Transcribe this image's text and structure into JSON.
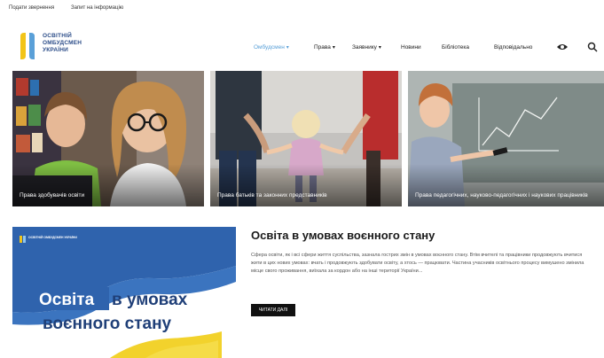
{
  "topbar": {
    "links": [
      "Подати звернення",
      "Запит на інформацію"
    ]
  },
  "logo": {
    "line1": "ОСВІТНІЙ",
    "line2": "ОМБУДСМЕН",
    "line3": "УКРАЇНИ"
  },
  "nav": {
    "items": [
      {
        "label": "Омбудсмен",
        "has_dropdown": true,
        "active": true
      },
      {
        "label": "Права",
        "has_dropdown": true
      },
      {
        "label": "Заявнику",
        "has_dropdown": true
      },
      {
        "label": "Новини",
        "has_dropdown": false
      },
      {
        "label": "Бібліотека",
        "has_dropdown": false
      },
      {
        "label": "Відповідально",
        "has_dropdown": false
      }
    ],
    "icons": [
      "eye-icon",
      "search-icon"
    ]
  },
  "tiles": [
    {
      "caption": "Права здобувачів освіти"
    },
    {
      "caption": "Права батьків та законних представників"
    },
    {
      "caption": "Права педагогічних, науково-педагогічних і наукових працівників"
    }
  ],
  "feature": {
    "image_line1_word1": "Освіта",
    "image_line1_word2": "в умовах",
    "image_line2": "воєнного стану",
    "image_logo_text": "ОСВІТНІЙ ОМБУДСМЕН УКРАЇНИ"
  },
  "article": {
    "title": "Освіта в умовах воєнного стану",
    "body": "Сфера освіти, як і всі сфери життя суспільства, зазнала гострих змін в умовах воєнного стану. Втім вчителі та працівники продовжують вчитися жити в цих нових умовах: вчать і продовжують здобувати освіту, а хтось — працювати. Частина учасників освітнього процесу вимушено змінила місце свого проживання, виїхала за кордон або на інші території України...",
    "button": "ЧИТАТИ ДАЛІ"
  },
  "colors": {
    "accent": "#5aa0d8",
    "brand_blue": "#2b4c88",
    "flag_blue": "#2f63ad",
    "flag_yellow": "#f2d22c"
  }
}
